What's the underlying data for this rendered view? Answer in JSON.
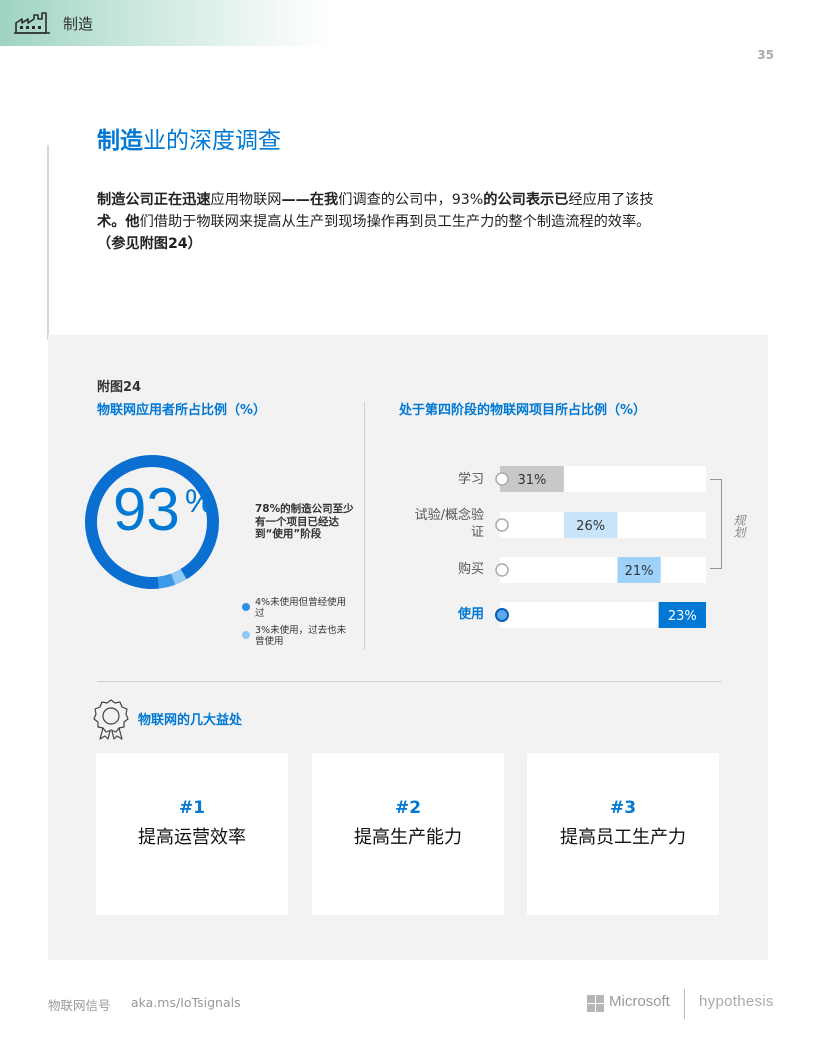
{
  "header": {
    "title": "制造",
    "icon": "factory-icon"
  },
  "page_number": "35",
  "section": {
    "title_bold": "制造",
    "title_rest": "业的深度调查"
  },
  "intro": {
    "p1_bold1": "制造公司正在迅速",
    "p1_normal1": "应用物联网",
    "p1_bold2": "——在我",
    "p1_normal2": "们调查的公司中，93%",
    "p1_bold3": "的公司表示已",
    "p1_normal3": "经应用了该技",
    "line2_bold": "术。他",
    "line2_normal": "们借助于物联网来提高从生产到现场操作再到员工生产力的整个制造流程的效率。",
    "line3": "（参见附图24）"
  },
  "figure": {
    "label": "附图24",
    "left_title": "物联网应用者所占比例（%）",
    "right_title": "处于第四阶段的物联网项目所占比例（%）"
  },
  "donut": {
    "big_value": "93",
    "percent_sign": "%",
    "note": "78%的制造公司至少有一个项目已经达到“使用”阶段",
    "legend": [
      {
        "text": "4%未使用但曾经使用过",
        "color": "#2e8ee8"
      },
      {
        "text": "3%未使用，过去也未曾使用",
        "color": "#8ec8f5"
      }
    ],
    "segments": [
      {
        "name": "using",
        "value": 93,
        "color": "#0a6fd0"
      },
      {
        "name": "used-before",
        "value": 4,
        "color": "#3b9ae8"
      },
      {
        "name": "never",
        "value": 3,
        "color": "#8fcaf6"
      }
    ]
  },
  "chart_data": {
    "type": "bar",
    "title": "处于第四阶段的物联网项目所占比例（%）",
    "categories": [
      "学习",
      "试验/概念验证",
      "购买",
      "使用"
    ],
    "values": [
      31,
      26,
      21,
      23
    ],
    "value_labels": [
      "31%",
      "26%",
      "21%",
      "23%"
    ],
    "colors": [
      "#c8c8c8",
      "#c7e4fb",
      "#9ed2fb",
      "#0078d4"
    ],
    "bracket_label": "规划",
    "xlim": [
      0,
      100
    ]
  },
  "benefits": {
    "title": "物联网的几大益处",
    "items": [
      {
        "num": "#1",
        "text": "提高运营效率"
      },
      {
        "num": "#2",
        "text": "提高生产能力"
      },
      {
        "num": "#3",
        "text": "提高员工生产力"
      }
    ]
  },
  "footer": {
    "left": "物联网信号",
    "link": "aka.ms/IoTsignals",
    "brand1": "Microsoft",
    "brand2": "hypothesis"
  }
}
